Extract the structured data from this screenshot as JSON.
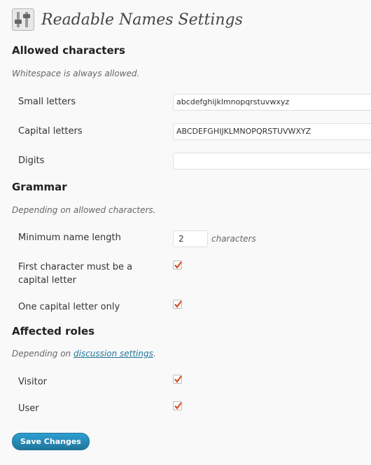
{
  "header": {
    "title": "Readable Names Settings",
    "icon": "settings-sliders-icon"
  },
  "sections": {
    "allowed": {
      "title": "Allowed characters",
      "description": "Whitespace is always allowed.",
      "fields": {
        "small": {
          "label": "Small letters",
          "value": "abcdefghijklmnopqrstuvwxyz"
        },
        "capital": {
          "label": "Capital letters",
          "value": "ABCDEFGHIJKLMNOPQRSTUVWXYZ"
        },
        "digits": {
          "label": "Digits",
          "value": ""
        }
      }
    },
    "grammar": {
      "title": "Grammar",
      "description": "Depending on allowed characters.",
      "min_length": {
        "label": "Minimum name length",
        "value": "2",
        "unit": "characters"
      },
      "first_capital": {
        "label": "First character must be a capital letter",
        "checked": true
      },
      "one_capital": {
        "label": "One capital letter only",
        "checked": true
      }
    },
    "roles": {
      "title": "Affected roles",
      "description_prefix": "Depending on ",
      "description_link": "discussion settings",
      "description_suffix": ".",
      "visitor": {
        "label": "Visitor",
        "checked": true
      },
      "user": {
        "label": "User",
        "checked": true
      }
    }
  },
  "save_label": "Save Changes",
  "colors": {
    "accent": "#21759b",
    "checkmark": "#d54e21"
  }
}
